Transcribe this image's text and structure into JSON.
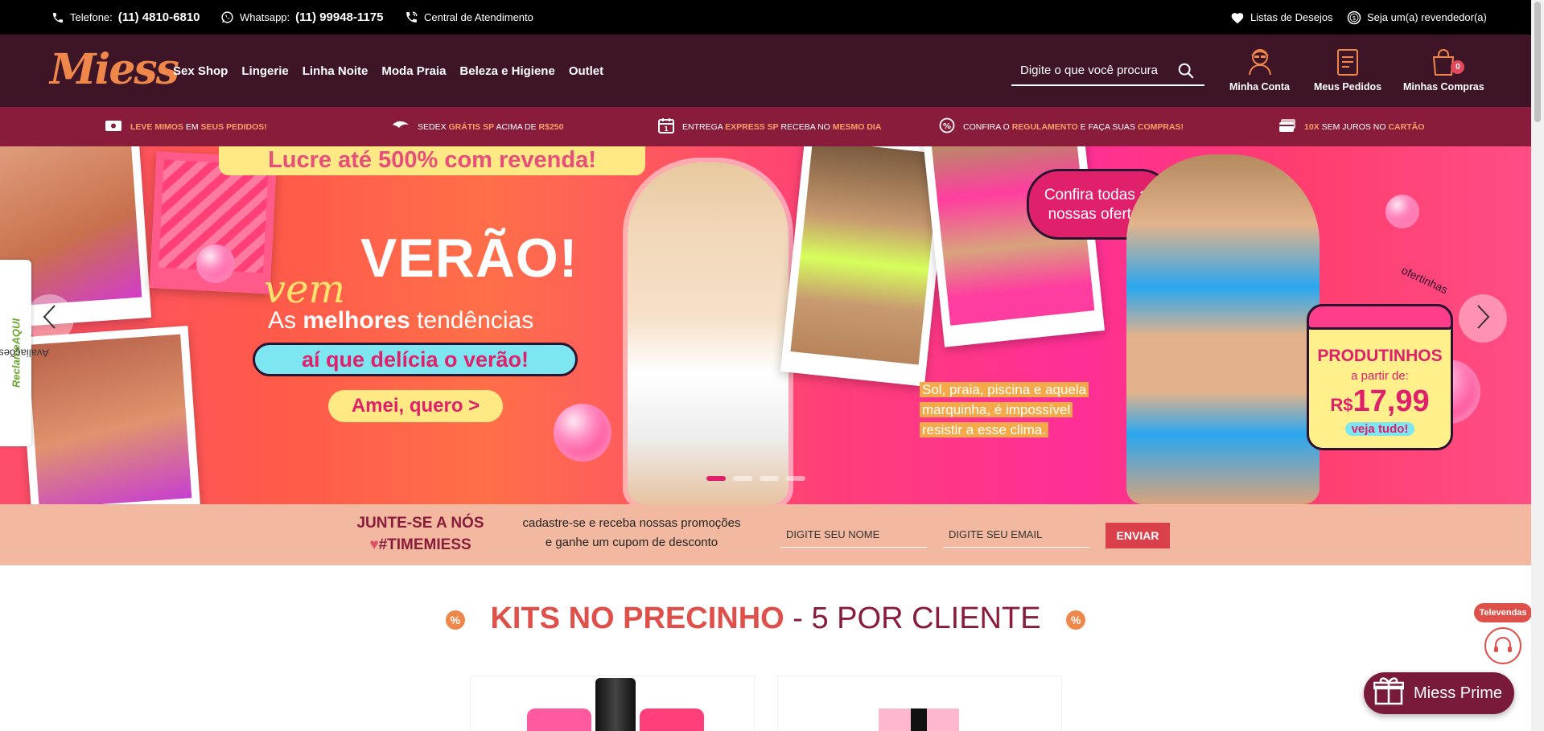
{
  "topbar": {
    "phone_label": "Telefone:",
    "phone": "(11) 4810-6810",
    "whatsapp_label": "Whatsapp:",
    "whatsapp": "(11) 99948-1175",
    "support": "Central de Atendimento",
    "wishlist": "Listas de Desejos",
    "reseller": "Seja um(a) revendedor(a)"
  },
  "header": {
    "logo": "Miess",
    "nav": [
      "Sex Shop",
      "Lingerie",
      "Linha Noite",
      "Moda Praia",
      "Beleza e Higiene",
      "Outlet"
    ],
    "search_placeholder": "Digite o que você procura",
    "account": "Minha Conta",
    "orders": "Meus Pedidos",
    "cart": "Minhas Compras",
    "cart_count": "0"
  },
  "benefits": [
    {
      "parts": [
        {
          "t": "Leve mimos",
          "em": true
        },
        {
          "t": " em ",
          "em": false
        },
        {
          "t": "seus pedidos!",
          "em": true
        }
      ]
    },
    {
      "parts": [
        {
          "t": "Sedex ",
          "em": false
        },
        {
          "t": "grátis SP",
          "em": true
        },
        {
          "t": " acima de ",
          "em": false
        },
        {
          "t": "R$250",
          "em": true
        }
      ]
    },
    {
      "parts": [
        {
          "t": "Entrega ",
          "em": false
        },
        {
          "t": "express SP",
          "em": true
        },
        {
          "t": " receba no ",
          "em": false
        },
        {
          "t": "mesmo dia",
          "em": true
        }
      ]
    },
    {
      "parts": [
        {
          "t": "Confira o ",
          "em": false
        },
        {
          "t": "regulamento",
          "em": true
        },
        {
          "t": " e faça suas ",
          "em": false
        },
        {
          "t": "compras!",
          "em": true
        }
      ]
    },
    {
      "parts": [
        {
          "t": "10x",
          "em": true
        },
        {
          "t": " sem juros no ",
          "em": false
        },
        {
          "t": "cartão",
          "em": true
        }
      ]
    }
  ],
  "banner": {
    "promo_top": "Lucre até 500% com revenda!",
    "vem": "vem",
    "verao": "VERÃO!",
    "tendencias_pre": "As ",
    "tendencias_bold": "melhores",
    "tendencias_post": " tendências",
    "delicia": "aí que delícia o verão!",
    "cta": "Amei, quero >",
    "confira": "Confira todas as nossas ofertas!",
    "sol_lines": [
      "Sol, praia, piscina e aquela",
      "marquinha, é impossível",
      "resistir a esse clima."
    ],
    "ofertinhas": "ofertinhas",
    "produtinhos": "PRODUTINHOS",
    "a_partir": "a partir de:",
    "currency": "R$",
    "price": "17,99",
    "veja": "veja tudo!",
    "slides_total": 4,
    "active_slide": 1,
    "reclame": "Avaliações do",
    "reclame_brand": "ReclameAQUI"
  },
  "newsletter": {
    "join_line1": "JUNTE-SE A NÓS",
    "join_line2": "#TIMEMIESS",
    "text_line1": "cadastre-se e receba nossas promoções",
    "text_line2": "e ganhe um cupom de desconto",
    "name_placeholder": "DIGITE SEU NOME",
    "email_placeholder": "DIGITE SEU EMAIL",
    "send": "ENVIAR"
  },
  "section": {
    "title_highlight": "KITS NO PRECINHO",
    "title_rest": " - 5 POR CLIENTE",
    "badge": "%"
  },
  "floating": {
    "televendas": "Televendas",
    "prime": "Miess Prime"
  },
  "colors": {
    "topbar": "#000000",
    "header": "#3e1427",
    "benefits": "#8a1c3b",
    "accent": "#f0874a",
    "newsletter": "#f3b9a0",
    "button": "#d94049"
  }
}
